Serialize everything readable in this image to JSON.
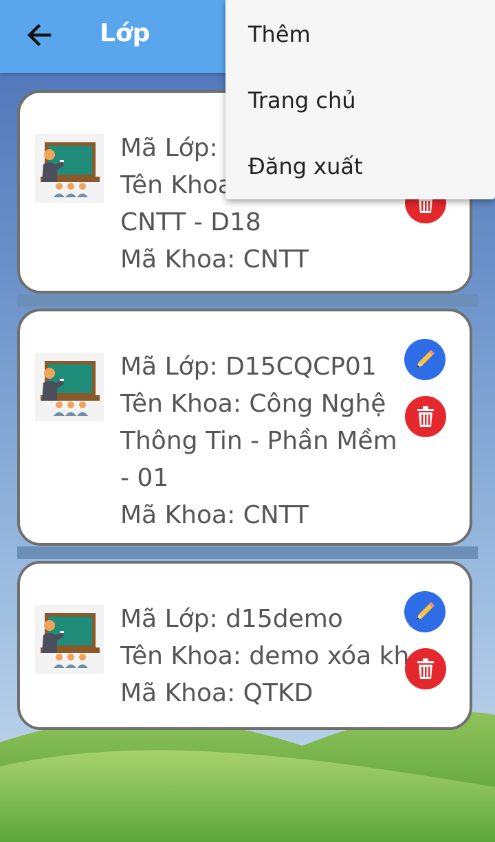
{
  "header": {
    "title": "Lớp"
  },
  "menu": {
    "items": [
      "Thêm",
      "Trang chủ",
      "Đăng xuất"
    ]
  },
  "cards": [
    {
      "code_line": "Mã Lớp: ",
      "name_line": "Tên Khoa",
      "name_line2": "CNTT - D18",
      "dept_line": "Mã Khoa: CNTT"
    },
    {
      "code_line": "Mã Lớp: D15CQCP01",
      "name_line": "Tên Khoa: Công Nghệ",
      "name_line2": "Thông Tin - Phần Mềm",
      "name_line3": "- 01",
      "dept_line": "Mã Khoa: CNTT"
    },
    {
      "code_line": "Mã Lớp: d15demo",
      "name_line": "Tên Khoa: demo xóa kh",
      "dept_line": "Mã Khoa: QTKD"
    }
  ],
  "colors": {
    "app_bar": "#5aa6ec",
    "edit": "#2f6de6",
    "delete": "#e5282d"
  }
}
